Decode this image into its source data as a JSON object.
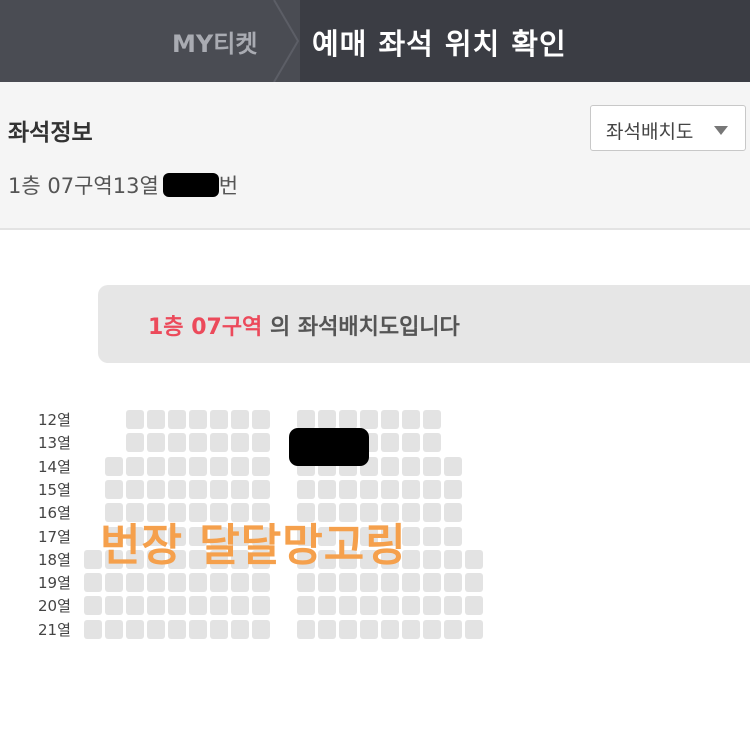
{
  "header": {
    "breadcrumb": "MY티켓",
    "title": "예매 좌석 위치 확인"
  },
  "seat_info": {
    "title": "좌석정보",
    "seat_prefix": "1층 07구역13열",
    "seat_suffix": "번",
    "layout_button_label": "좌석배치도"
  },
  "banner": {
    "highlight": "1층 07구역",
    "text": " 의 좌석배치도입니다"
  },
  "seat_map": {
    "rows": [
      "12열",
      "13열",
      "14열",
      "15열",
      "16열",
      "17열",
      "18열",
      "19열",
      "20열",
      "21열"
    ]
  },
  "watermark": "번장 달달망고링",
  "colors": {
    "header_bg": "#3b3d44",
    "breadcrumb_bg": "#4a4c53",
    "info_bg": "#f5f5f5",
    "highlight": "#ec4a5b",
    "seat": "#e3e3e3",
    "watermark": "#f5a04c"
  }
}
